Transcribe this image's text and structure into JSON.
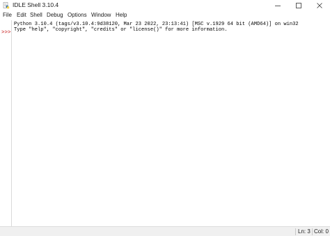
{
  "window": {
    "title": "IDLE Shell 3.10.4"
  },
  "menubar": {
    "items": [
      "File",
      "Edit",
      "Shell",
      "Debug",
      "Options",
      "Window",
      "Help"
    ]
  },
  "shell": {
    "lines": [
      "Python 3.10.4 (tags/v3.10.4:9d38120, Mar 23 2022, 23:13:41) [MSC v.1929 64 bit (AMD64)] on win32",
      "Type \"help\", \"copyright\", \"credits\" or \"license()\" for more information."
    ],
    "prompt": ">>>"
  },
  "status": {
    "line": "Ln: 3",
    "col": "Col: 0"
  },
  "colors": {
    "prompt": "#c00000",
    "icon_blue": "#3572a5",
    "icon_yellow": "#f7d44c"
  },
  "icons": {
    "app": "python-idle-icon",
    "minimize": "minimize-icon",
    "maximize": "maximize-icon",
    "close": "close-icon"
  }
}
